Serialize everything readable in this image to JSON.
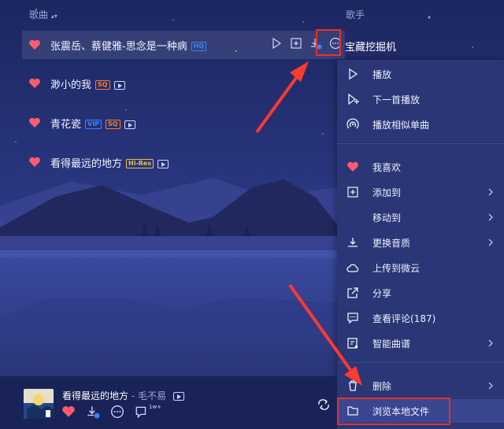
{
  "header": {
    "song_col": "歌曲",
    "artist_col": "歌手"
  },
  "songs": [
    {
      "title": "张震岳、蔡健雅-思念是一种病",
      "badges": [
        "HQ"
      ]
    },
    {
      "title": "渺小的我",
      "badges": [
        "SQ",
        "MV"
      ]
    },
    {
      "title": "青花瓷",
      "badges": [
        "VIP",
        "SQ",
        "MV"
      ]
    },
    {
      "title": "看得最远的地方",
      "badges": [
        "Hi-Res",
        "MV"
      ]
    }
  ],
  "row_actions": [
    "play-icon",
    "add-icon",
    "download-icon",
    "more-icon"
  ],
  "artist_first_row": "宝藏挖掘机",
  "context_menu": {
    "items": [
      {
        "label": "播放",
        "icon": "play-icon",
        "submenu": false
      },
      {
        "label": "下一首播放",
        "icon": "play-next-icon",
        "submenu": false
      },
      {
        "label": "播放相似单曲",
        "icon": "radar-icon",
        "submenu": false
      },
      {
        "label": "我喜欢",
        "icon": "heart-icon",
        "submenu": false
      },
      {
        "label": "添加到",
        "icon": "add-icon",
        "submenu": true
      },
      {
        "label": "移动到",
        "icon": "",
        "submenu": true
      },
      {
        "label": "更换音质",
        "icon": "download-icon",
        "submenu": true
      },
      {
        "label": "上传到微云",
        "icon": "cloud-icon",
        "submenu": false
      },
      {
        "label": "分享",
        "icon": "share-icon",
        "submenu": false
      },
      {
        "label": "查看评论(187)",
        "icon": "comment-icon",
        "submenu": false
      },
      {
        "label": "智能曲谱",
        "icon": "score-icon",
        "submenu": true
      },
      {
        "label": "删除",
        "icon": "trash-icon",
        "submenu": true
      },
      {
        "label": "浏览本地文件",
        "icon": "folder-icon",
        "submenu": false
      }
    ]
  },
  "player": {
    "now_playing_title": "看得最远的地方",
    "now_playing_sep": " - ",
    "now_playing_artist": "毛不易",
    "comment_count": "1w+"
  },
  "colors": {
    "background": "#1f2a63",
    "menu_bg": "#2a3675",
    "heart": "#ff5b6e",
    "highlight_box": "#e8302b",
    "arrow": "#ff3a2f"
  }
}
